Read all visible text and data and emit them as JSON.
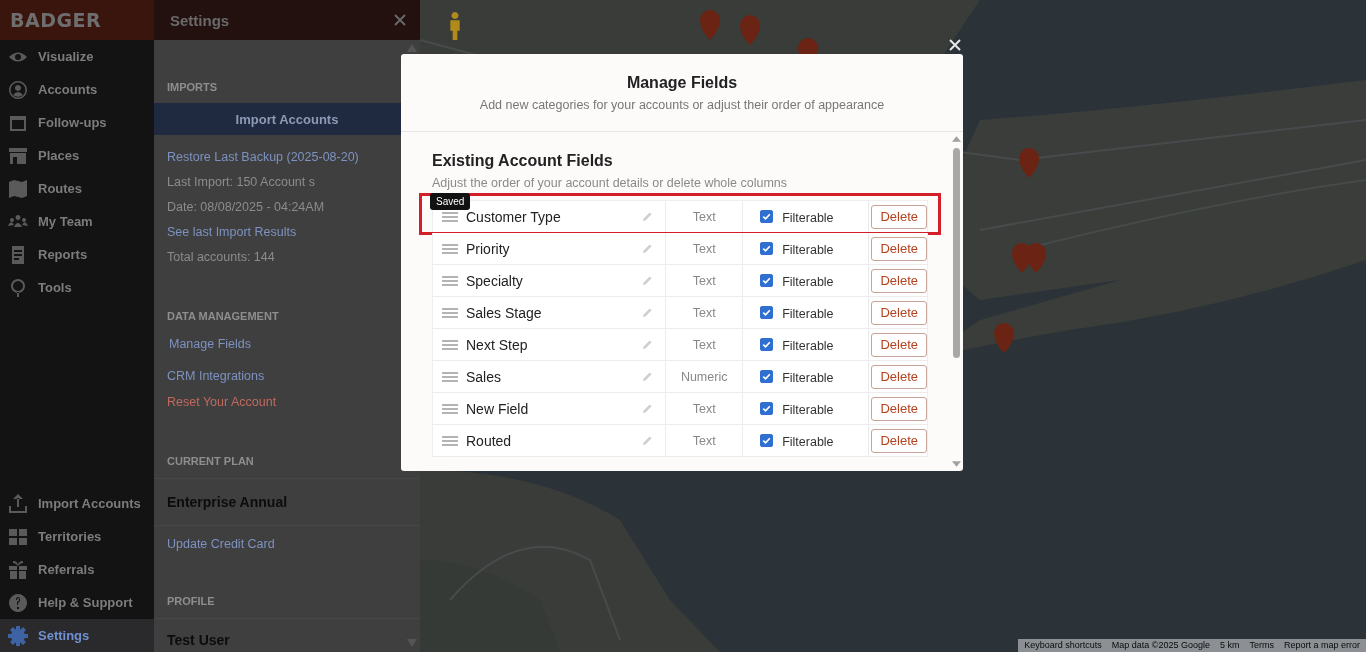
{
  "logo": "BADGER",
  "nav": {
    "top": [
      {
        "label": "Visualize",
        "selected": false
      },
      {
        "label": "Accounts",
        "selected": false
      },
      {
        "label": "Follow-ups",
        "selected": false
      },
      {
        "label": "Places",
        "selected": false
      },
      {
        "label": "Routes",
        "selected": false
      },
      {
        "label": "My Team",
        "selected": false
      },
      {
        "label": "Reports",
        "selected": false
      },
      {
        "label": "Tools",
        "selected": false
      }
    ],
    "bottom": [
      {
        "label": "Import Accounts",
        "selected": false
      },
      {
        "label": "Territories",
        "selected": false
      },
      {
        "label": "Referrals",
        "selected": false
      },
      {
        "label": "Help & Support",
        "selected": false
      },
      {
        "label": "Settings",
        "selected": true
      }
    ]
  },
  "settings": {
    "title": "Settings",
    "imports": {
      "heading": "IMPORTS",
      "button": "Import Accounts",
      "items": [
        {
          "kind": "link",
          "text": "Restore Last Backup (2025-08-20)"
        },
        {
          "kind": "info",
          "text": "Last Import: 150 Account s"
        },
        {
          "kind": "info",
          "text": "Date: 08/08/2025 - 04:24AM"
        },
        {
          "kind": "link",
          "text": "See last Import Results"
        },
        {
          "kind": "info",
          "text": "Total accounts: 144"
        }
      ]
    },
    "data_management": {
      "heading": "DATA MANAGEMENT",
      "items": [
        {
          "kind": "link",
          "text": "Manage Fields"
        },
        {
          "kind": "link",
          "text": "CRM Integrations"
        },
        {
          "kind": "danger",
          "text": "Reset Your Account"
        }
      ]
    },
    "current_plan": {
      "heading": "CURRENT PLAN",
      "plan": "Enterprise Annual",
      "link": "Update Credit Card"
    },
    "profile": {
      "heading": "PROFILE",
      "name": "Test User"
    }
  },
  "modal": {
    "title": "Manage Fields",
    "subtitle": "Add new categories for your accounts or adjust their order of appearance",
    "section_title": "Existing Account Fields",
    "section_subtitle": "Adjust the order of your account details or delete whole columns",
    "fields": [
      {
        "name": "Customer Type",
        "type": "Text",
        "filterable": true,
        "filter_label": "Filterable",
        "action": "Delete",
        "highlighted": true,
        "tooltip": "Saved"
      },
      {
        "name": "Priority",
        "type": "Text",
        "filterable": true,
        "filter_label": "Filterable",
        "action": "Delete",
        "highlighted": false
      },
      {
        "name": "Specialty",
        "type": "Text",
        "filterable": true,
        "filter_label": "Filterable",
        "action": "Delete",
        "highlighted": false
      },
      {
        "name": "Sales Stage",
        "type": "Text",
        "filterable": true,
        "filter_label": "Filterable",
        "action": "Delete",
        "highlighted": false
      },
      {
        "name": "Next Step",
        "type": "Text",
        "filterable": true,
        "filter_label": "Filterable",
        "action": "Delete",
        "highlighted": false
      },
      {
        "name": "Sales",
        "type": "Numeric",
        "filterable": true,
        "filter_label": "Filterable",
        "action": "Delete",
        "highlighted": false
      },
      {
        "name": "New Field",
        "type": "Text",
        "filterable": true,
        "filter_label": "Filterable",
        "action": "Delete",
        "highlighted": false
      },
      {
        "name": "Routed",
        "type": "Text",
        "filterable": true,
        "filter_label": "Filterable",
        "action": "Delete",
        "highlighted": false
      }
    ]
  },
  "map_footer": [
    "Keyboard shortcuts",
    "Map data ©2025 Google",
    "5 km",
    "Terms",
    "Report a map error"
  ]
}
